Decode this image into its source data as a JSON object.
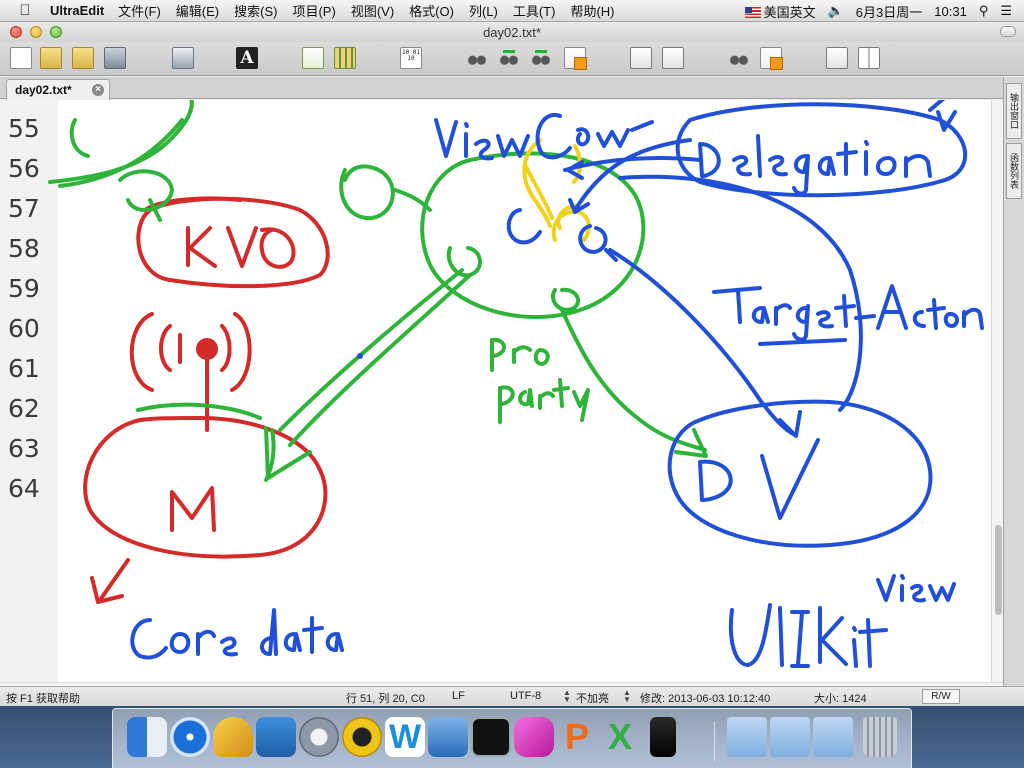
{
  "menubar": {
    "app_name": "UltraEdit",
    "menus": [
      "文件(F)",
      "编辑(E)",
      "搜索(S)",
      "项目(P)",
      "视图(V)",
      "格式(O)",
      "列(L)",
      "工具(T)",
      "帮助(H)"
    ],
    "input_method": "美国英文",
    "date": "6月3日周一",
    "time": "10:31"
  },
  "window": {
    "title": "day02.txt*"
  },
  "toolbar": {
    "font_button_label": "A",
    "binary_icon_text": "10 01 10"
  },
  "tabs": [
    {
      "label": "day02.txt*",
      "close_glyph": "×"
    }
  ],
  "side_panels": [
    "输出窗口",
    "函数列表"
  ],
  "editor": {
    "line_numbers": [
      "55",
      "56",
      "57",
      "58",
      "59",
      "60",
      "61",
      "62",
      "63",
      "64"
    ]
  },
  "status": {
    "help": "按 F1 获取帮助",
    "position": "行 51, 列 20, C0",
    "line_ending": "LF",
    "encoding": "UTF-8",
    "highlight": "不加亮",
    "modified": "修改: 2013-06-03 10:12:40",
    "size": "大小: 1424",
    "mode": "R/W"
  },
  "colors": {
    "ink_red": "#d42a2a",
    "ink_green": "#2fb43a",
    "ink_blue": "#2150d8",
    "ink_yellow": "#f0d21c"
  },
  "icons": {
    "apple": "apple-logo-icon",
    "volume": "volume-icon",
    "search": "spotlight-search-icon",
    "list": "notification-list-icon"
  }
}
